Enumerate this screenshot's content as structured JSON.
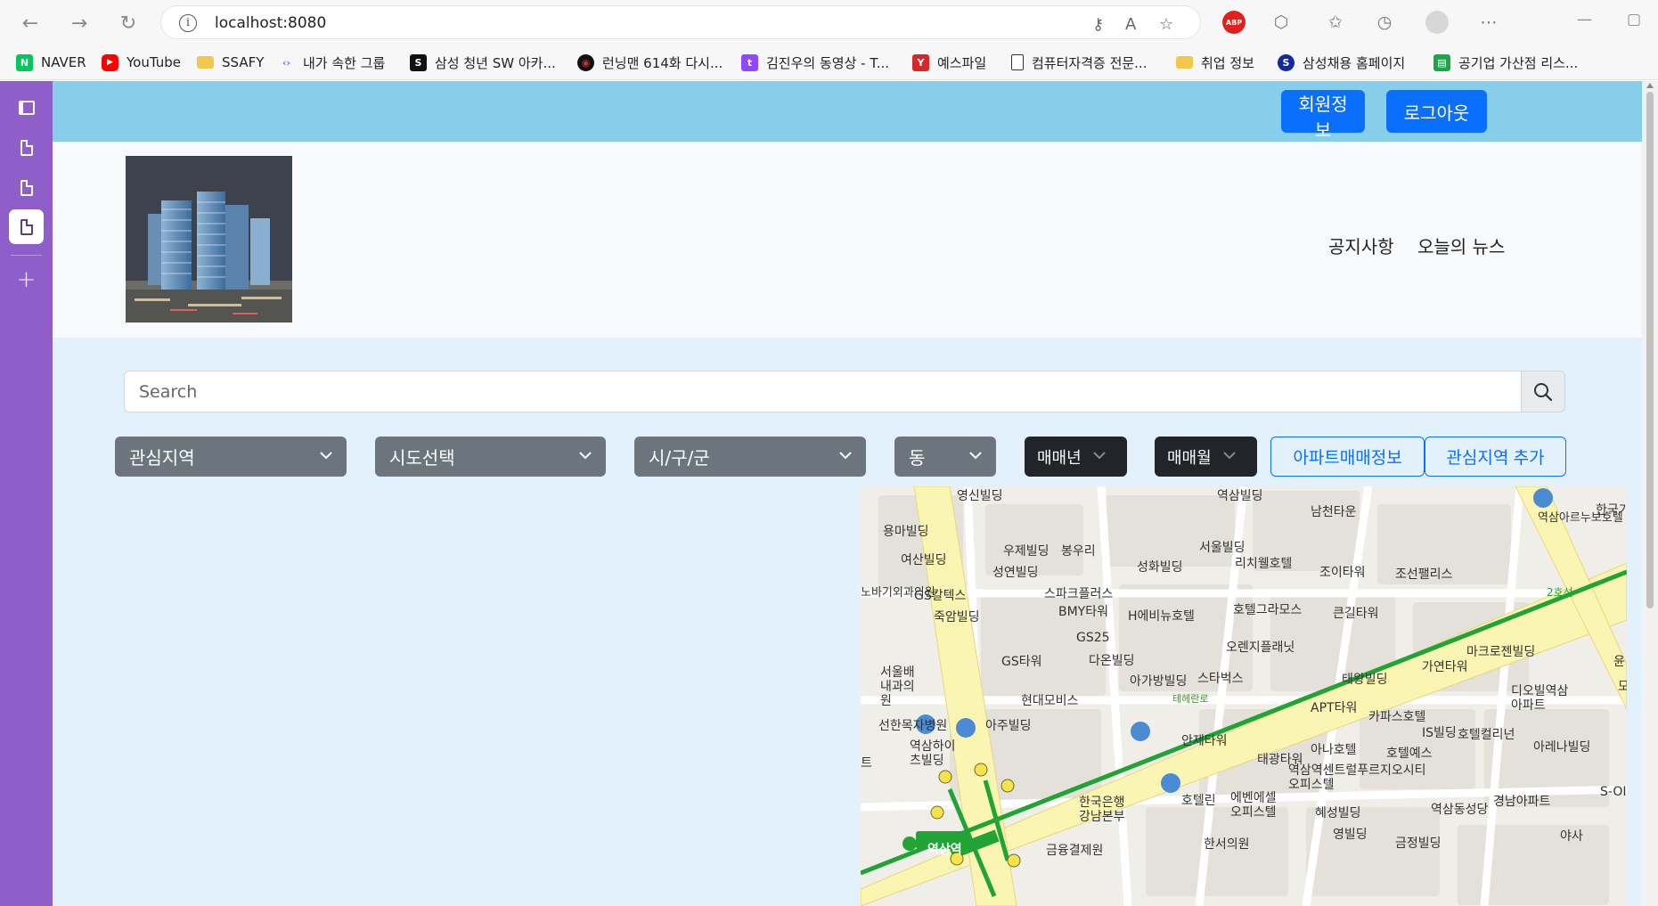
{
  "browser": {
    "url": "localhost:8080",
    "bookmarks": [
      {
        "label": "NAVER",
        "icon": "naver-icon",
        "color": "#03c75a",
        "glyph": "N"
      },
      {
        "label": "YouTube",
        "icon": "youtube-icon",
        "color": "#ff0000",
        "glyph": "▶"
      },
      {
        "label": "SSAFY",
        "icon": "folder-icon",
        "color": "#f3c74b",
        "glyph": ""
      },
      {
        "label": "내가 속한 그룹",
        "icon": "code-icon",
        "color": "#5b7fd6",
        "glyph": "‹›"
      },
      {
        "label": "삼성 청년 SW 아카...",
        "icon": "ssafy-icon",
        "color": "#111111",
        "glyph": "S"
      },
      {
        "label": "런닝맨 614화 다시...",
        "icon": "video-icon",
        "color": "#111111",
        "glyph": "◉"
      },
      {
        "label": "김진우의 동영상 - T...",
        "icon": "twitch-icon",
        "color": "#9146ff",
        "glyph": "t"
      },
      {
        "label": "예스파일",
        "icon": "yesfile-icon",
        "color": "#d62828",
        "glyph": "Y"
      },
      {
        "label": "컴퓨터자격증 전문...",
        "icon": "page-icon",
        "color": "#ffffff",
        "glyph": ""
      },
      {
        "label": "취업 정보",
        "icon": "folder-icon",
        "color": "#f3c74b",
        "glyph": ""
      },
      {
        "label": "삼성채용 홈페이지",
        "icon": "samsung-icon",
        "color": "#1428a0",
        "glyph": "S"
      },
      {
        "label": "공기업 가산점 리스...",
        "icon": "list-icon",
        "color": "#18a84a",
        "glyph": "▤"
      }
    ]
  },
  "topbar": {
    "member_info": "회원정보",
    "logout": "로그아웃"
  },
  "nav": {
    "notice": "공지사항",
    "news": "오늘의 뉴스"
  },
  "search": {
    "placeholder": "Search"
  },
  "filters": {
    "interest_area": "관심지역",
    "sido": "시도선택",
    "gugun": "시/구/군",
    "dong": "동",
    "year": "매매년",
    "month": "매매월",
    "apt_deal_button": "아파트매매정보",
    "add_interest_button": "관심지역 추가"
  },
  "map": {
    "line_label": "2호선",
    "road_label": "테헤란로",
    "station": "역삼역",
    "labels": [
      "영신빌딩",
      "역삼빌딩",
      "남천타운",
      "역삼아르누보호텔",
      "한국기",
      "용마빌딩",
      "여산빌딩",
      "우제빌딩",
      "봉우리",
      "서울빌딩",
      "리치웰호텔",
      "조이타워",
      "조선팰리스",
      "노바기외과의원",
      "GS칼텍스",
      "성연빌딩",
      "성화빌딩",
      "스파크플러스",
      "BMY타워",
      "H에비뉴호텔",
      "호텔그라모스",
      "큰길타워",
      "죽암빌딩",
      "GS25",
      "다온빌딩",
      "오렌지플래닛",
      "마크로젠빌딩",
      "GS타워",
      "서울배내과의원",
      "스타벅스",
      "아가방빌딩",
      "가연타워",
      "태왕빌딩",
      "윤",
      "현대모비스",
      "APT타워",
      "카파스호텔",
      "디오빌역삼아파트",
      "모",
      "선한목자병원",
      "아주빌딩",
      "안제타워",
      "IS빌딩",
      "호텔컬리넌",
      "역삼하이츠빌딩",
      "아나호텔",
      "호텔예스",
      "아레나빌딩",
      "태광타워",
      "역삼역센트럴푸르지오시티오피스텔",
      "한국은행강남본부",
      "호텔린",
      "에벤에셀오피스텔",
      "혜성빌딩",
      "역삼동성당",
      "경남아파트",
      "S-OIL",
      "영빌딩",
      "금정빌딩",
      "야사",
      "한서의원",
      "금융결제원",
      "트"
    ]
  },
  "colors": {
    "topbar": "#87ceea",
    "primary": "#0b6ffd",
    "sidebar": "#8e5fc9",
    "page_bg": "#e3f1fc"
  }
}
